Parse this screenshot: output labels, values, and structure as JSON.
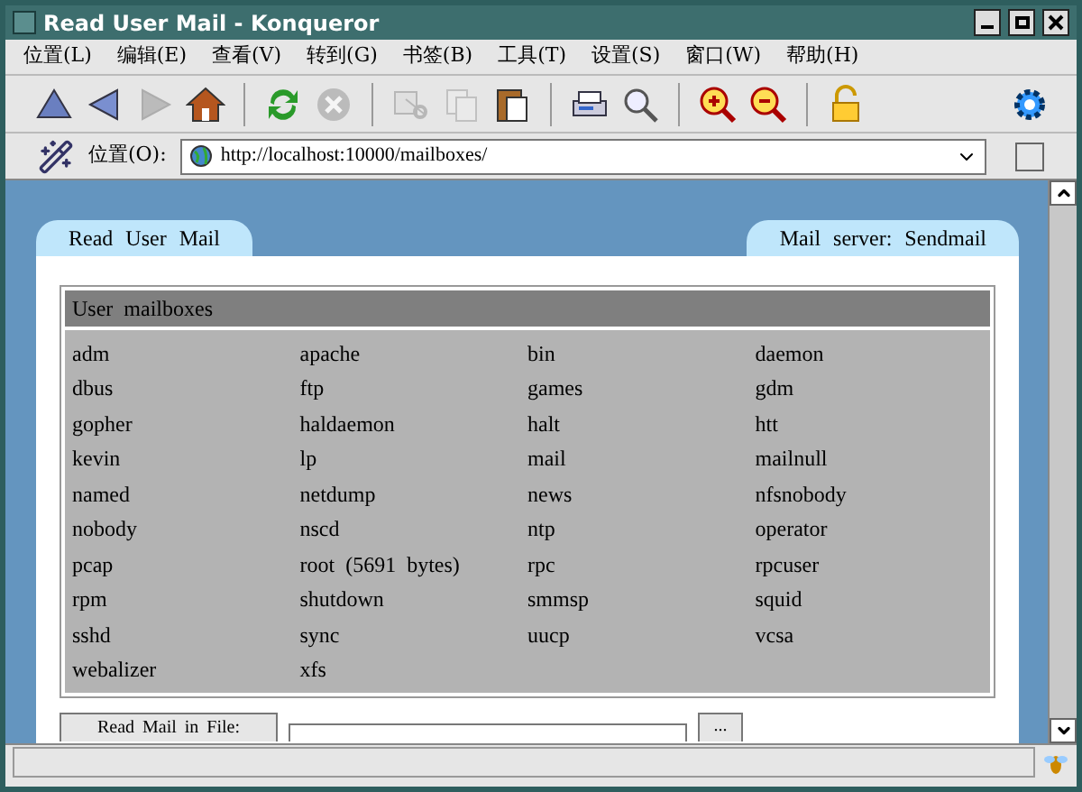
{
  "window": {
    "title": "Read User Mail - Konqueror"
  },
  "menu": [
    "位置(L)",
    "编辑(E)",
    "查看(V)",
    "转到(G)",
    "书签(B)",
    "工具(T)",
    "设置(S)",
    "窗口(W)",
    "帮助(H)"
  ],
  "toolbar": [
    {
      "kind": "up",
      "disabled": false
    },
    {
      "kind": "back",
      "disabled": false
    },
    {
      "kind": "forward",
      "disabled": true
    },
    {
      "kind": "home",
      "disabled": false
    },
    {
      "kind": "sep"
    },
    {
      "kind": "reload",
      "disabled": false
    },
    {
      "kind": "stop",
      "disabled": true
    },
    {
      "kind": "sep"
    },
    {
      "kind": "cut",
      "disabled": true
    },
    {
      "kind": "copy",
      "disabled": true
    },
    {
      "kind": "paste",
      "disabled": false
    },
    {
      "kind": "sep"
    },
    {
      "kind": "print",
      "disabled": false
    },
    {
      "kind": "find",
      "disabled": false
    },
    {
      "kind": "sep"
    },
    {
      "kind": "zoom-in",
      "disabled": false
    },
    {
      "kind": "zoom-out",
      "disabled": false
    },
    {
      "kind": "sep"
    },
    {
      "kind": "lock",
      "disabled": false
    }
  ],
  "location": {
    "label": "位置(O):",
    "value": "http://localhost:10000/mailboxes/"
  },
  "page": {
    "left_tab": "Read User Mail",
    "right_tab": "Mail server: Sendmail",
    "table": {
      "header": "User mailboxes",
      "rows": [
        [
          "adm",
          "apache",
          "bin",
          "daemon"
        ],
        [
          "dbus",
          "ftp",
          "games",
          "gdm"
        ],
        [
          "gopher",
          "haldaemon",
          "halt",
          "htt"
        ],
        [
          "kevin",
          "lp",
          "mail",
          "mailnull"
        ],
        [
          "named",
          "netdump",
          "news",
          "nfsnobody"
        ],
        [
          "nobody",
          "nscd",
          "ntp",
          "operator"
        ],
        [
          "pcap",
          "root (5691 bytes)",
          "rpc",
          "rpcuser"
        ],
        [
          "rpm",
          "shutdown",
          "smmsp",
          "squid"
        ],
        [
          "sshd",
          "sync",
          "uucp",
          "vcsa"
        ],
        [
          "webalizer",
          "xfs"
        ]
      ]
    },
    "file_button": "Read Mail in File:",
    "browse_button": "..."
  }
}
